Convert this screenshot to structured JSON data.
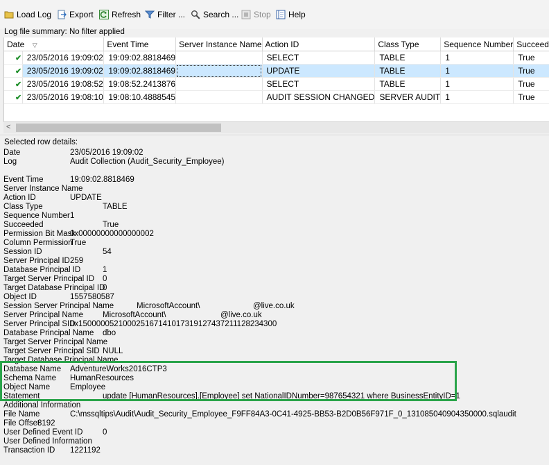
{
  "toolbar": {
    "load_log": "Load Log",
    "export": "Export",
    "refresh": "Refresh",
    "filter": "Filter ...",
    "search": "Search ...",
    "stop": "Stop",
    "help": "Help"
  },
  "summary": "Log file summary: No filter applied",
  "grid": {
    "columns": [
      "Date",
      "Event Time",
      "Server Instance Name",
      "Action ID",
      "Class Type",
      "Sequence Number",
      "Succeed"
    ],
    "rows": [
      {
        "date": "23/05/2016 19:09:02",
        "event_time": "19:09:02.8818469",
        "server": "",
        "action": "SELECT",
        "class": "TABLE",
        "seq": "1",
        "succeeded": "True"
      },
      {
        "date": "23/05/2016 19:09:02",
        "event_time": "19:09:02.8818469",
        "server": "",
        "action": "UPDATE",
        "class": "TABLE",
        "seq": "1",
        "succeeded": "True"
      },
      {
        "date": "23/05/2016 19:08:52",
        "event_time": "19:08:52.2413876",
        "server": "",
        "action": "SELECT",
        "class": "TABLE",
        "seq": "1",
        "succeeded": "True"
      },
      {
        "date": "23/05/2016 19:08:10",
        "event_time": "19:08:10.4888545",
        "server": "",
        "action": "AUDIT SESSION CHANGED",
        "class": "SERVER AUDIT",
        "seq": "1",
        "succeeded": "True"
      }
    ]
  },
  "details": {
    "header": "Selected row details:",
    "fields": [
      {
        "label": "Date",
        "value": "23/05/2016 19:09:02"
      },
      {
        "label": "Log",
        "value": "Audit Collection (Audit_Security_Employee)"
      },
      {
        "label": "Event Time",
        "value": "19:09:02.8818469"
      },
      {
        "label": "Server Instance Name",
        "value": ""
      },
      {
        "label": "Action ID",
        "value": "UPDATE"
      },
      {
        "label": "Class Type",
        "value": "TABLE"
      },
      {
        "label": "Sequence Number",
        "value": "1"
      },
      {
        "label": "Succeeded",
        "value": "True"
      },
      {
        "label": "Permission Bit Mask",
        "value": "0x00000000000000002"
      },
      {
        "label": "Column Permission",
        "value": "True"
      },
      {
        "label": "Session ID",
        "value": "54"
      },
      {
        "label": "Server Principal ID",
        "value": "259"
      },
      {
        "label": "Database Principal ID",
        "value": "1"
      },
      {
        "label": "Target Server Principal ID",
        "value": "0"
      },
      {
        "label": "Target Database Principal ID",
        "value": "0"
      },
      {
        "label": "Object ID",
        "value": "1557580587"
      },
      {
        "label": "Session Server Principal Name",
        "value": "MicrosoftAccount\\",
        "value2": "@live.co.uk"
      },
      {
        "label": "Server Principal Name",
        "value": "MicrosoftAccount\\",
        "value2": "@live.co.uk"
      },
      {
        "label": "Server Principal SID",
        "value": "0x150000052100025167141017319127437211128234300"
      },
      {
        "label": "Database Principal Name",
        "value": "dbo"
      },
      {
        "label": "Target Server Principal Name",
        "value": ""
      },
      {
        "label": "Target Server Principal SID",
        "value": "NULL"
      },
      {
        "label": "Target Database Principal Name",
        "value": ""
      },
      {
        "label": "Database Name",
        "value": "AdventureWorks2016CTP3"
      },
      {
        "label": "Schema Name",
        "value": "HumanResources"
      },
      {
        "label": "Object Name",
        "value": "Employee"
      },
      {
        "label": "Statement",
        "value": "update  [HumanResources].[Employee] set NationalIDNumber=987654321 where BusinessEntityID=1"
      },
      {
        "label": "Additional Information",
        "value": ""
      },
      {
        "label": "File Name",
        "value": "C:\\mssqltips\\Audit\\Audit_Security_Employee_F9FF84A3-0C41-4925-BB53-B2D0B56F971F_0_131085040904350000.sqlaudit"
      },
      {
        "label": "File Offset",
        "value": "8192"
      },
      {
        "label": "User Defined Event ID",
        "value": "0"
      },
      {
        "label": "User Defined Information",
        "value": ""
      },
      {
        "label": "Transaction ID",
        "value": "1221192"
      }
    ]
  },
  "colors": {
    "selected_row": "#cce8ff",
    "highlight_border": "#2aa44a",
    "check": "#1f8f2a"
  }
}
